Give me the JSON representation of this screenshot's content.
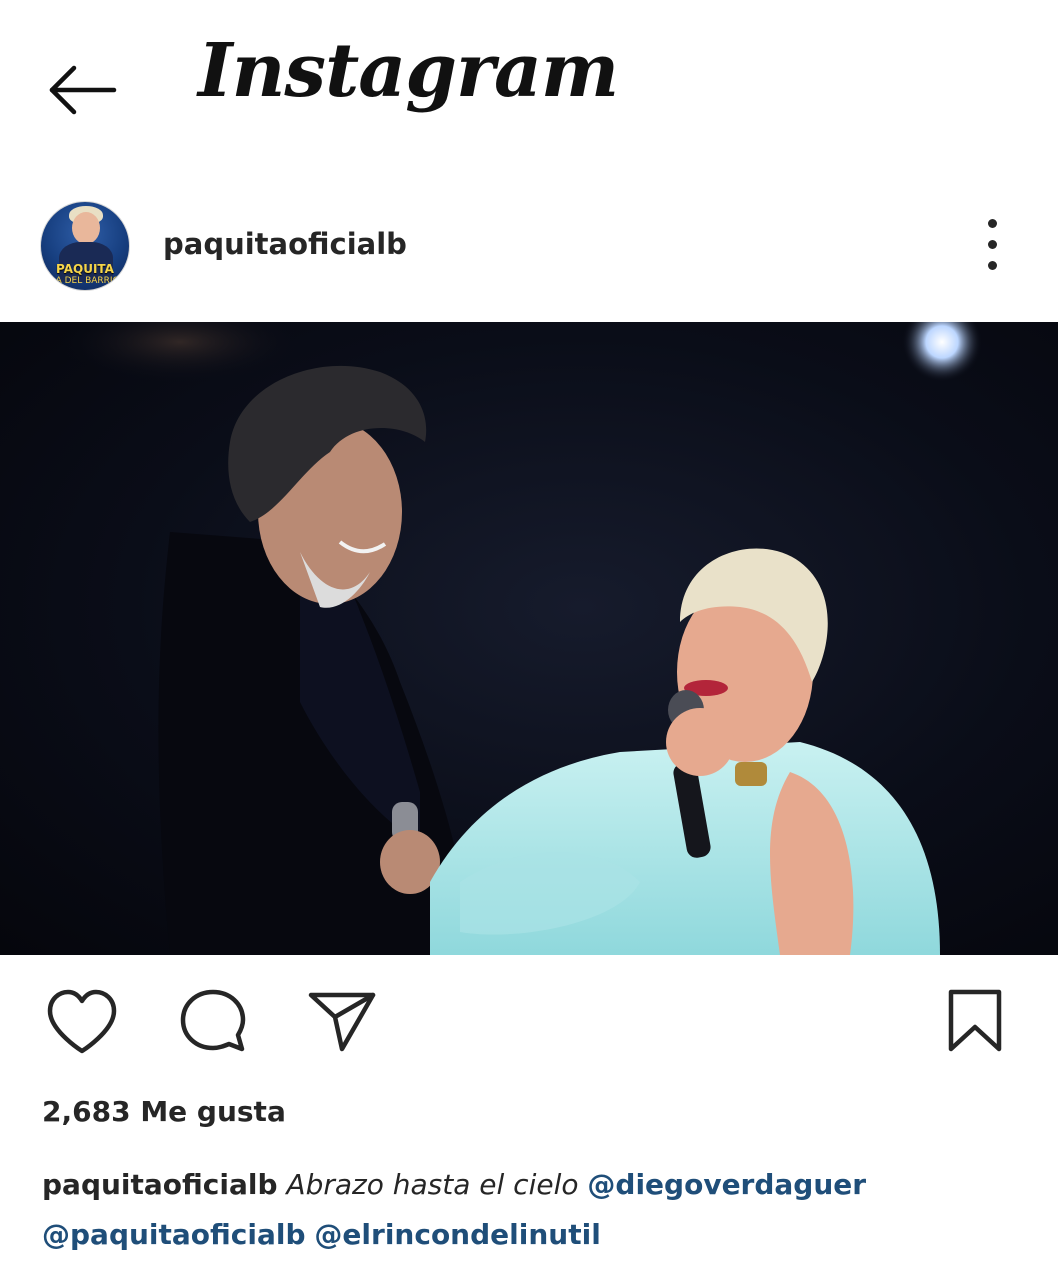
{
  "app": {
    "title": "Instagram"
  },
  "post": {
    "username": "paquitaoficialb",
    "avatar_text_line1": "PAQUITA",
    "avatar_text_line2": "LA DEL BARRIO",
    "likes_text": "2,683 Me gusta",
    "caption": {
      "username": "paquitaoficialb",
      "text": "Abrazo hasta el cielo",
      "mentions": [
        "@diegoverdaguer",
        "@paquitaoficialb",
        "@elrincondelinutil"
      ]
    }
  },
  "icons": {
    "back": "back-arrow-icon",
    "more": "more-vertical-icon",
    "like": "heart-icon",
    "comment": "comment-icon",
    "share": "send-icon",
    "save": "bookmark-icon"
  },
  "colors": {
    "text": "#262626",
    "mention": "#1f4e79",
    "background": "#ffffff"
  }
}
